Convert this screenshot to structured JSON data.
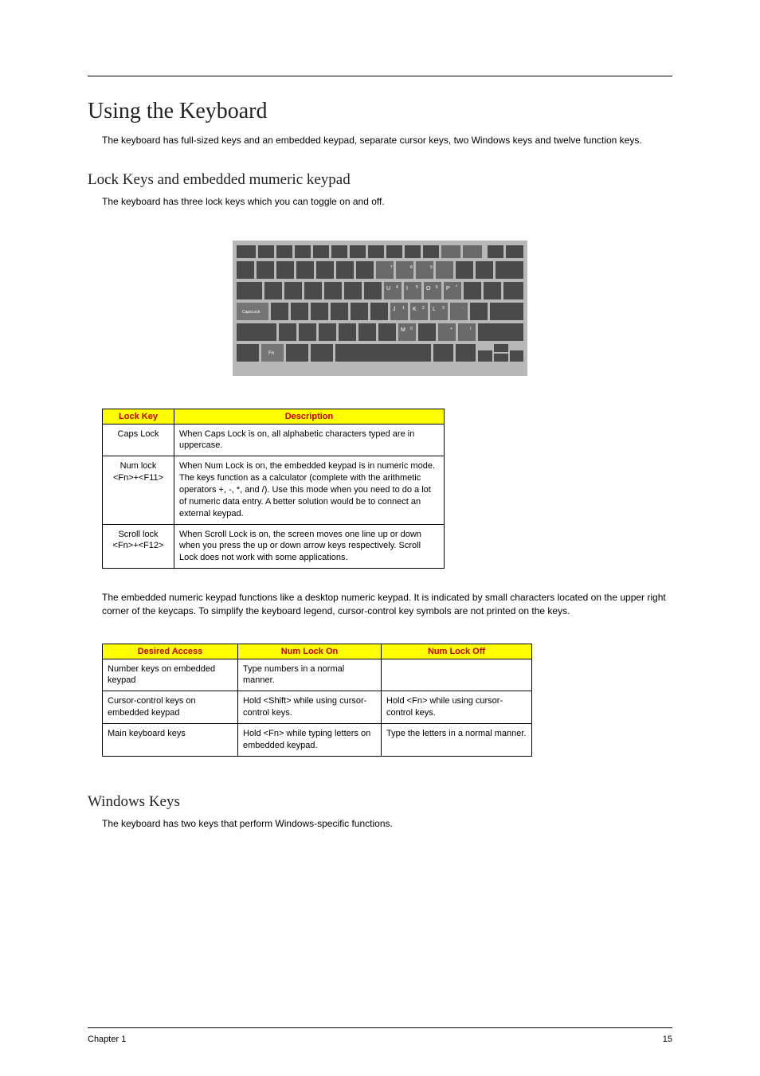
{
  "title": "Using the Keyboard",
  "intro": "The keyboard has full-sized keys and an embedded keypad, separate cursor keys, two Windows keys and twelve function keys.",
  "section1": {
    "heading": "Lock Keys and embedded mumeric keypad",
    "text": "The keyboard has three lock keys which you can toggle on and off."
  },
  "table1": {
    "headers": {
      "col1": "Lock Key",
      "col2": "Description"
    },
    "rows": [
      {
        "key": "Caps Lock",
        "desc": "When Caps Lock is on, all alphabetic characters typed are in uppercase."
      },
      {
        "key": "Num lock <Fn>+<F11>",
        "desc": "When Num Lock is on, the embedded keypad is in numeric mode. The keys function as a calculator (complete with the arithmetic operators +, -, *, and /). Use this mode when you need to do a lot of numeric data entry. A better solution would be to connect an external keypad."
      },
      {
        "key": "Scroll lock <Fn>+<F12>",
        "desc": "When Scroll Lock is on, the screen moves one line up or down when you press the up or down arrow keys respectively. Scroll Lock does not work with some applications."
      }
    ]
  },
  "para2": "The embedded numeric keypad functions like a desktop numeric keypad. It is indicated by small characters located on the upper right corner of the keycaps. To simplify the keyboard legend, cursor-control key symbols are not printed on the keys.",
  "table2": {
    "headers": {
      "col1": "Desired Access",
      "col2": "Num Lock On",
      "col3": "Num Lock Off"
    },
    "rows": [
      {
        "c1": "Number keys on embedded keypad",
        "c2": "Type numbers in a normal manner.",
        "c3": ""
      },
      {
        "c1": "Cursor-control keys on embedded keypad",
        "c2": "Hold <Shift> while using cursor-control keys.",
        "c3": "Hold <Fn> while using cursor-control keys."
      },
      {
        "c1": "Main keyboard keys",
        "c2": "Hold <Fn> while typing letters on embedded keypad.",
        "c3": "Type the letters in a normal manner."
      }
    ]
  },
  "section2": {
    "heading": "Windows Keys",
    "text": "The keyboard has two keys that perform Windows-specific functions."
  },
  "footer": {
    "left": "Chapter 1",
    "right": "15"
  },
  "kbd_labels": {
    "capslock": "CapsLock",
    "fn": "Fn",
    "u": "U",
    "i": "I",
    "o": "O",
    "p": "P",
    "j": "J",
    "k": "K",
    "l": "L",
    "m": "M",
    "n4": "4",
    "n5": "5",
    "n6": "6",
    "nstar": "*",
    "n1": "1",
    "n2": "2",
    "n3": "3",
    "nminus": "-",
    "n0": "0",
    "ndot": ".",
    "nplus": "+",
    "nslash": "/",
    "n7": "7",
    "n8": "8",
    "n9": "9"
  }
}
